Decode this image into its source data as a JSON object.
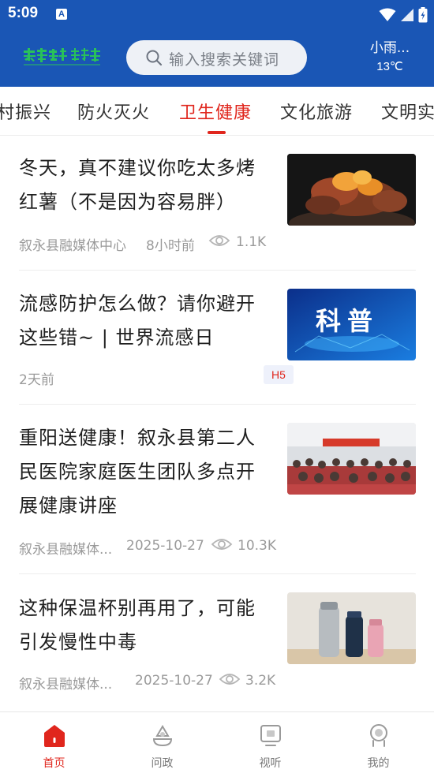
{
  "status_bar": {
    "time": "5:09",
    "notification_badge": "A"
  },
  "header": {
    "logo_name": "app-logo",
    "search": {
      "placeholder": "输入搜索关键词"
    },
    "weather": {
      "description": "小雨...",
      "temperature": "13℃"
    }
  },
  "tabs": [
    {
      "label": "村振兴"
    },
    {
      "label": "防火灭火"
    },
    {
      "label": "卫生健康",
      "active": true
    },
    {
      "label": "文化旅游"
    },
    {
      "label": "文明实"
    }
  ],
  "news": [
    {
      "title": "冬天，真不建议你吃太多烤红薯（不是因为容易胖）",
      "source": "叙永县融媒体中心",
      "time": "8小时前",
      "views": "1.1K",
      "thumbnail": "baked-sweet-potato"
    },
    {
      "title": "流感防护怎么做？请你避开这些错~ | 世界流感日",
      "time": "2天前",
      "badge": "H5",
      "thumbnail": "science-banner",
      "thumbnail_text": "科普"
    },
    {
      "title": "重阳送健康！叙永县第二人民医院家庭医生团队多点开展健康讲座",
      "source": "叙永县融媒体...",
      "time": "2025-10-27",
      "views": "10.3K",
      "thumbnail": "health-lecture-photo"
    },
    {
      "title": "这种保温杯别再用了，可能引发慢性中毒",
      "source": "叙永县融媒体...",
      "time": "2025-10-27",
      "views": "3.2K",
      "thumbnail": "thermos-cups"
    }
  ],
  "bottom_nav": [
    {
      "label": "首页",
      "icon": "home-icon",
      "active": true
    },
    {
      "label": "问政",
      "icon": "inquiry-icon"
    },
    {
      "label": "视听",
      "icon": "media-icon"
    },
    {
      "label": "我的",
      "icon": "profile-icon"
    }
  ],
  "colors": {
    "brand_blue": "#1a56b5",
    "accent_red": "#e0261d"
  }
}
